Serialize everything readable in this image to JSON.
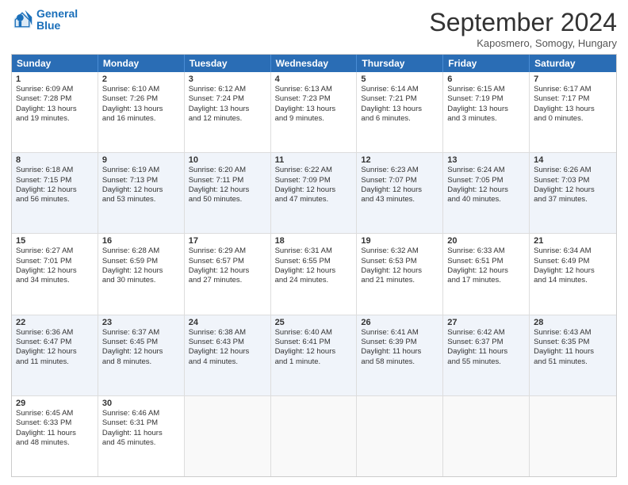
{
  "header": {
    "logo_line1": "General",
    "logo_line2": "Blue",
    "month": "September 2024",
    "location": "Kaposmero, Somogy, Hungary"
  },
  "days_of_week": [
    "Sunday",
    "Monday",
    "Tuesday",
    "Wednesday",
    "Thursday",
    "Friday",
    "Saturday"
  ],
  "rows": [
    [
      {
        "day": "",
        "lines": [],
        "empty": true
      },
      {
        "day": "2",
        "lines": [
          "Sunrise: 6:10 AM",
          "Sunset: 7:26 PM",
          "Daylight: 13 hours",
          "and 16 minutes."
        ]
      },
      {
        "day": "3",
        "lines": [
          "Sunrise: 6:12 AM",
          "Sunset: 7:24 PM",
          "Daylight: 13 hours",
          "and 12 minutes."
        ]
      },
      {
        "day": "4",
        "lines": [
          "Sunrise: 6:13 AM",
          "Sunset: 7:23 PM",
          "Daylight: 13 hours",
          "and 9 minutes."
        ]
      },
      {
        "day": "5",
        "lines": [
          "Sunrise: 6:14 AM",
          "Sunset: 7:21 PM",
          "Daylight: 13 hours",
          "and 6 minutes."
        ]
      },
      {
        "day": "6",
        "lines": [
          "Sunrise: 6:15 AM",
          "Sunset: 7:19 PM",
          "Daylight: 13 hours",
          "and 3 minutes."
        ]
      },
      {
        "day": "7",
        "lines": [
          "Sunrise: 6:17 AM",
          "Sunset: 7:17 PM",
          "Daylight: 13 hours",
          "and 0 minutes."
        ]
      }
    ],
    [
      {
        "day": "8",
        "lines": [
          "Sunrise: 6:18 AM",
          "Sunset: 7:15 PM",
          "Daylight: 12 hours",
          "and 56 minutes."
        ]
      },
      {
        "day": "9",
        "lines": [
          "Sunrise: 6:19 AM",
          "Sunset: 7:13 PM",
          "Daylight: 12 hours",
          "and 53 minutes."
        ]
      },
      {
        "day": "10",
        "lines": [
          "Sunrise: 6:20 AM",
          "Sunset: 7:11 PM",
          "Daylight: 12 hours",
          "and 50 minutes."
        ]
      },
      {
        "day": "11",
        "lines": [
          "Sunrise: 6:22 AM",
          "Sunset: 7:09 PM",
          "Daylight: 12 hours",
          "and 47 minutes."
        ]
      },
      {
        "day": "12",
        "lines": [
          "Sunrise: 6:23 AM",
          "Sunset: 7:07 PM",
          "Daylight: 12 hours",
          "and 43 minutes."
        ]
      },
      {
        "day": "13",
        "lines": [
          "Sunrise: 6:24 AM",
          "Sunset: 7:05 PM",
          "Daylight: 12 hours",
          "and 40 minutes."
        ]
      },
      {
        "day": "14",
        "lines": [
          "Sunrise: 6:26 AM",
          "Sunset: 7:03 PM",
          "Daylight: 12 hours",
          "and 37 minutes."
        ]
      }
    ],
    [
      {
        "day": "15",
        "lines": [
          "Sunrise: 6:27 AM",
          "Sunset: 7:01 PM",
          "Daylight: 12 hours",
          "and 34 minutes."
        ]
      },
      {
        "day": "16",
        "lines": [
          "Sunrise: 6:28 AM",
          "Sunset: 6:59 PM",
          "Daylight: 12 hours",
          "and 30 minutes."
        ]
      },
      {
        "day": "17",
        "lines": [
          "Sunrise: 6:29 AM",
          "Sunset: 6:57 PM",
          "Daylight: 12 hours",
          "and 27 minutes."
        ]
      },
      {
        "day": "18",
        "lines": [
          "Sunrise: 6:31 AM",
          "Sunset: 6:55 PM",
          "Daylight: 12 hours",
          "and 24 minutes."
        ]
      },
      {
        "day": "19",
        "lines": [
          "Sunrise: 6:32 AM",
          "Sunset: 6:53 PM",
          "Daylight: 12 hours",
          "and 21 minutes."
        ]
      },
      {
        "day": "20",
        "lines": [
          "Sunrise: 6:33 AM",
          "Sunset: 6:51 PM",
          "Daylight: 12 hours",
          "and 17 minutes."
        ]
      },
      {
        "day": "21",
        "lines": [
          "Sunrise: 6:34 AM",
          "Sunset: 6:49 PM",
          "Daylight: 12 hours",
          "and 14 minutes."
        ]
      }
    ],
    [
      {
        "day": "22",
        "lines": [
          "Sunrise: 6:36 AM",
          "Sunset: 6:47 PM",
          "Daylight: 12 hours",
          "and 11 minutes."
        ]
      },
      {
        "day": "23",
        "lines": [
          "Sunrise: 6:37 AM",
          "Sunset: 6:45 PM",
          "Daylight: 12 hours",
          "and 8 minutes."
        ]
      },
      {
        "day": "24",
        "lines": [
          "Sunrise: 6:38 AM",
          "Sunset: 6:43 PM",
          "Daylight: 12 hours",
          "and 4 minutes."
        ]
      },
      {
        "day": "25",
        "lines": [
          "Sunrise: 6:40 AM",
          "Sunset: 6:41 PM",
          "Daylight: 12 hours",
          "and 1 minute."
        ]
      },
      {
        "day": "26",
        "lines": [
          "Sunrise: 6:41 AM",
          "Sunset: 6:39 PM",
          "Daylight: 11 hours",
          "and 58 minutes."
        ]
      },
      {
        "day": "27",
        "lines": [
          "Sunrise: 6:42 AM",
          "Sunset: 6:37 PM",
          "Daylight: 11 hours",
          "and 55 minutes."
        ]
      },
      {
        "day": "28",
        "lines": [
          "Sunrise: 6:43 AM",
          "Sunset: 6:35 PM",
          "Daylight: 11 hours",
          "and 51 minutes."
        ]
      }
    ],
    [
      {
        "day": "29",
        "lines": [
          "Sunrise: 6:45 AM",
          "Sunset: 6:33 PM",
          "Daylight: 11 hours",
          "and 48 minutes."
        ]
      },
      {
        "day": "30",
        "lines": [
          "Sunrise: 6:46 AM",
          "Sunset: 6:31 PM",
          "Daylight: 11 hours",
          "and 45 minutes."
        ]
      },
      {
        "day": "",
        "lines": [],
        "empty": true
      },
      {
        "day": "",
        "lines": [],
        "empty": true
      },
      {
        "day": "",
        "lines": [],
        "empty": true
      },
      {
        "day": "",
        "lines": [],
        "empty": true
      },
      {
        "day": "",
        "lines": [],
        "empty": true
      }
    ]
  ],
  "first_row": {
    "day1": {
      "day": "1",
      "lines": [
        "Sunrise: 6:09 AM",
        "Sunset: 7:28 PM",
        "Daylight: 13 hours",
        "and 19 minutes."
      ]
    }
  }
}
